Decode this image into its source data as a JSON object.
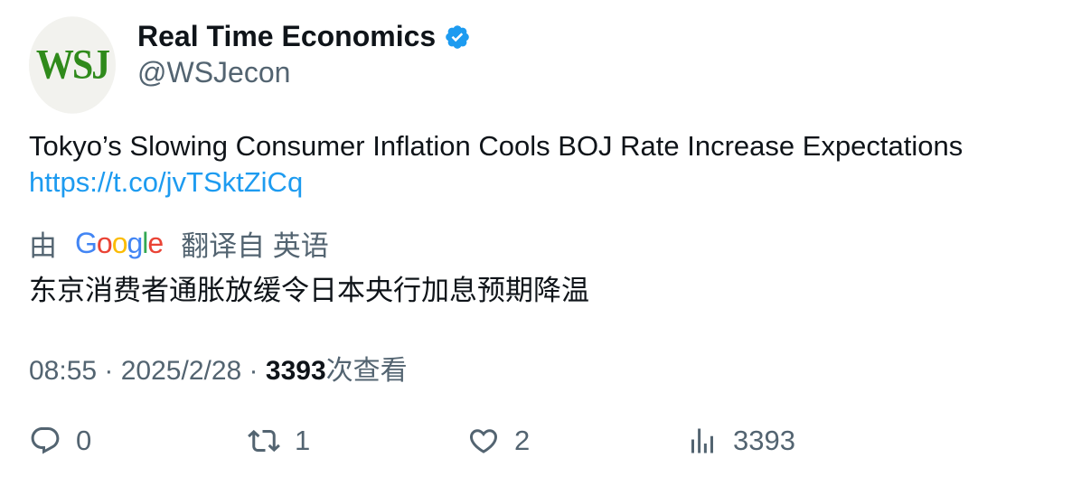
{
  "author": {
    "name": "Real Time Economics",
    "handle": "@WSJecon",
    "avatar_text": "WSJ",
    "verified": true
  },
  "tweet": {
    "text": "Tokyo’s Slowing Consumer Inflation Cools BOJ Rate Increase Expectations",
    "link": "https://t.co/jvTSktZiCq"
  },
  "translation": {
    "prefix": "由",
    "provider": "Google",
    "suffix": "翻译自 英语",
    "text": "东京消费者通胀放缓令日本央行加息预期降温"
  },
  "meta": {
    "time": "08:55",
    "separator": " · ",
    "date": "2025/2/28",
    "views_count": "3393",
    "views_label": "次查看"
  },
  "actions": {
    "replies": "0",
    "retweets": "1",
    "likes": "2",
    "views": "3393"
  },
  "colors": {
    "text": "#0f1419",
    "secondary": "#536471",
    "link": "#1d9bf0",
    "verified": "#1d9bf0",
    "avatar_bg": "#f2f2ee",
    "avatar_text": "#2f8a1b"
  }
}
